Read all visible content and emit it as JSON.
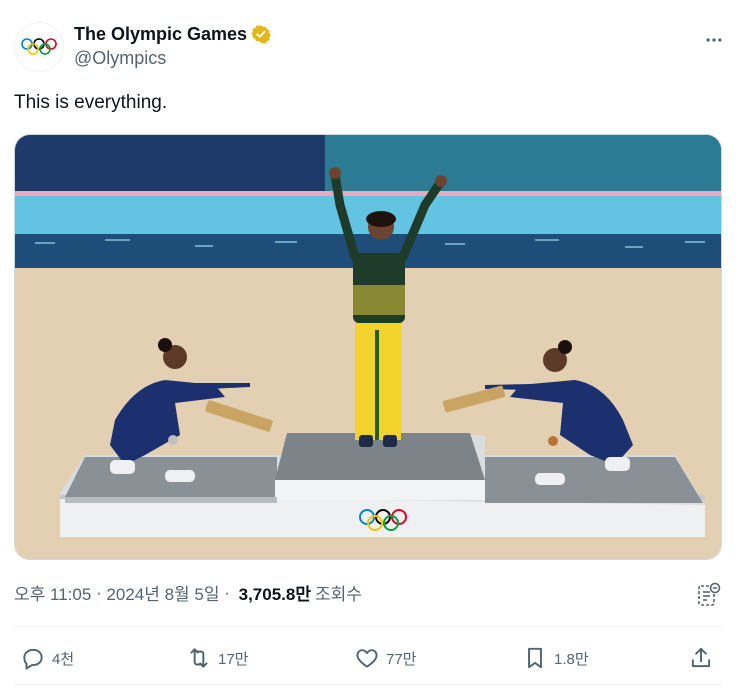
{
  "author": {
    "display_name": "The Olympic Games",
    "handle": "@Olympics",
    "avatar_icon": "olympic-rings-icon",
    "verified_icon": "gold-verified-badge-icon",
    "verified_color": "#e2b719"
  },
  "more_icon": "more-horizontal-icon",
  "tweet": {
    "text": "This is everything."
  },
  "media": {
    "type": "photo",
    "icon": "photo-gymnastics-podium"
  },
  "meta": {
    "time": "오후 11:05",
    "separator1": " · ",
    "date": "2024년 8월 5일",
    "separator2": " · ",
    "views_count": "3,705.8만",
    "views_label": "조회수",
    "analytics_icon": "analytics-icon"
  },
  "actions": {
    "reply": {
      "icon": "reply-icon",
      "count": "4천"
    },
    "repost": {
      "icon": "repost-icon",
      "count": "17만"
    },
    "like": {
      "icon": "heart-icon",
      "count": "77만"
    },
    "bookmark": {
      "icon": "bookmark-icon",
      "count": "1.8만"
    },
    "share": {
      "icon": "share-icon"
    }
  },
  "colors": {
    "text_primary": "#0f1419",
    "text_secondary": "#536471",
    "border": "#eff3f4"
  }
}
